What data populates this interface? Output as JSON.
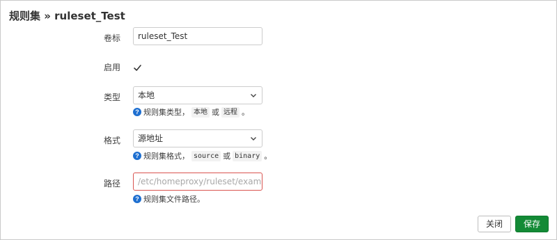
{
  "dialog": {
    "title": "规则集 » ruleset_Test"
  },
  "fields": {
    "label": {
      "label": "卷标",
      "value": "ruleset_Test"
    },
    "enabled": {
      "label": "启用",
      "checked": true
    },
    "type": {
      "label": "类型",
      "selected": "本地",
      "help_prefix": "规则集类型，",
      "help_code1": "本地",
      "help_or": "或",
      "help_code2": "远程",
      "help_suffix": "。"
    },
    "format": {
      "label": "格式",
      "selected": "源地址",
      "help_prefix": "规则集格式，",
      "help_code1": "source",
      "help_or": "或",
      "help_code2": "binary",
      "help_suffix": "。"
    },
    "path": {
      "label": "路径",
      "placeholder": "/etc/homeproxy/ruleset/example.js",
      "help": "规则集文件路径。",
      "error_color": "#d9534f"
    }
  },
  "buttons": {
    "close": "关闭",
    "save": "保存",
    "save_color": "#138a36"
  },
  "icons": {
    "help": "question-circle-icon",
    "dropdown": "chevron-down-icon",
    "checkbox": "checkmark-icon"
  },
  "help_icon_glyph": "?"
}
